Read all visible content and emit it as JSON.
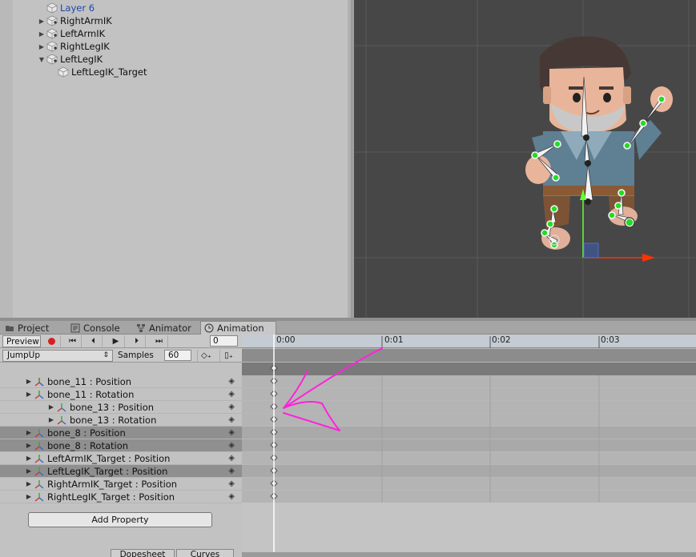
{
  "hierarchy": {
    "items": [
      {
        "label": "Layer 6",
        "expand": "",
        "selected_color": true
      },
      {
        "label": "RightArmIK",
        "expand": "▶"
      },
      {
        "label": "LeftArmIK",
        "expand": "▶"
      },
      {
        "label": "RightLegIK",
        "expand": "▶"
      },
      {
        "label": "LeftLegIK",
        "expand": "▼"
      },
      {
        "label": "LeftLegIK_Target",
        "expand": ""
      }
    ]
  },
  "tabs": {
    "project": "Project",
    "console": "Console",
    "animator": "Animator",
    "animation": "Animation"
  },
  "toolbar": {
    "preview_label": "Preview",
    "frame_value": "0",
    "clip_name": "JumpUp",
    "samples_label": "Samples",
    "samples_value": "60"
  },
  "properties": [
    {
      "label": "bone_11 : Position",
      "indent": 1,
      "selected": false
    },
    {
      "label": "bone_11 : Rotation",
      "indent": 1,
      "selected": false
    },
    {
      "label": "bone_13 : Position",
      "indent": 2,
      "selected": false
    },
    {
      "label": "bone_13 : Rotation",
      "indent": 2,
      "selected": false
    },
    {
      "label": "bone_8 : Position",
      "indent": 1,
      "selected": true
    },
    {
      "label": "bone_8 : Rotation",
      "indent": 1,
      "selected": true
    },
    {
      "label": "LeftArmIK_Target : Position",
      "indent": 1,
      "selected": false
    },
    {
      "label": "LeftLegIK_Target : Position",
      "indent": 1,
      "selected": true
    },
    {
      "label": "RightArmIK_Target : Position",
      "indent": 1,
      "selected": false
    },
    {
      "label": "RightLegIK_Target : Position",
      "indent": 1,
      "selected": false
    }
  ],
  "add_property_label": "Add Property",
  "bottom_tabs": {
    "dopesheet": "Dopesheet",
    "curves": "Curves"
  },
  "timeline": {
    "ticks": [
      "0:00",
      "0:01",
      "0:02",
      "0:03"
    ]
  },
  "colors": {
    "annotation": "#ff22dd",
    "joint": "#22dd22",
    "axis_x": "#ff3300",
    "axis_y": "#66ff33"
  }
}
